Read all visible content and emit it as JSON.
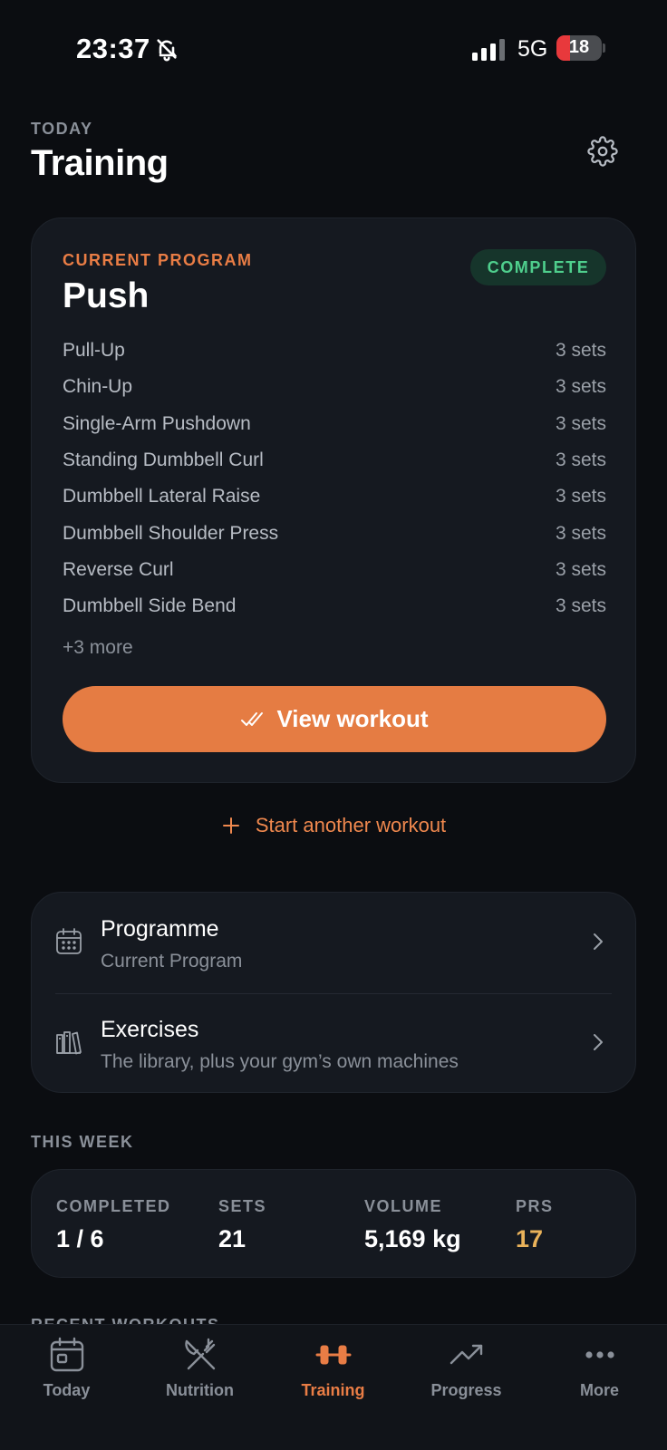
{
  "status_bar": {
    "time": "23:37",
    "network": "5G",
    "battery": "18"
  },
  "header": {
    "eyebrow": "TODAY",
    "title": "Training"
  },
  "program": {
    "eyebrow": "CURRENT PROGRAM",
    "name": "Push",
    "badge": "COMPLETE",
    "exercises": [
      {
        "name": "Pull-Up",
        "sets": "3 sets"
      },
      {
        "name": "Chin-Up",
        "sets": "3 sets"
      },
      {
        "name": "Single-Arm Pushdown",
        "sets": "3 sets"
      },
      {
        "name": "Standing Dumbbell Curl",
        "sets": "3 sets"
      },
      {
        "name": "Dumbbell Lateral Raise",
        "sets": "3 sets"
      },
      {
        "name": "Dumbbell Shoulder Press",
        "sets": "3 sets"
      },
      {
        "name": "Reverse Curl",
        "sets": "3 sets"
      },
      {
        "name": "Dumbbell Side Bend",
        "sets": "3 sets"
      }
    ],
    "more": "+3 more",
    "view_button": "View workout"
  },
  "start_another": "Start another workout",
  "nav": [
    {
      "title": "Programme",
      "subtitle": "Current Program",
      "icon": "calendar-icon"
    },
    {
      "title": "Exercises",
      "subtitle": "The library, plus your gym’s own machines",
      "icon": "library-icon"
    }
  ],
  "this_week": {
    "eyebrow": "THIS WEEK",
    "stats": [
      {
        "label": "COMPLETED",
        "value": "1 / 6"
      },
      {
        "label": "SETS",
        "value": "21"
      },
      {
        "label": "VOLUME",
        "value": "5,169 kg"
      },
      {
        "label": "PRS",
        "value": "17"
      }
    ]
  },
  "recent": {
    "eyebrow": "RECENT WORKOUTS"
  },
  "tabs": [
    {
      "label": "Today",
      "icon": "calendar-day-icon"
    },
    {
      "label": "Nutrition",
      "icon": "fork-knife-icon"
    },
    {
      "label": "Training",
      "icon": "dumbbell-icon"
    },
    {
      "label": "Progress",
      "icon": "trend-up-icon"
    },
    {
      "label": "More",
      "icon": "more-dots-icon"
    }
  ],
  "active_tab": "Training",
  "colors": {
    "accent": "#e57c43",
    "success": "#4fcf8d",
    "gold": "#e9b25a",
    "background": "#0b0d11",
    "card": "#151920"
  }
}
